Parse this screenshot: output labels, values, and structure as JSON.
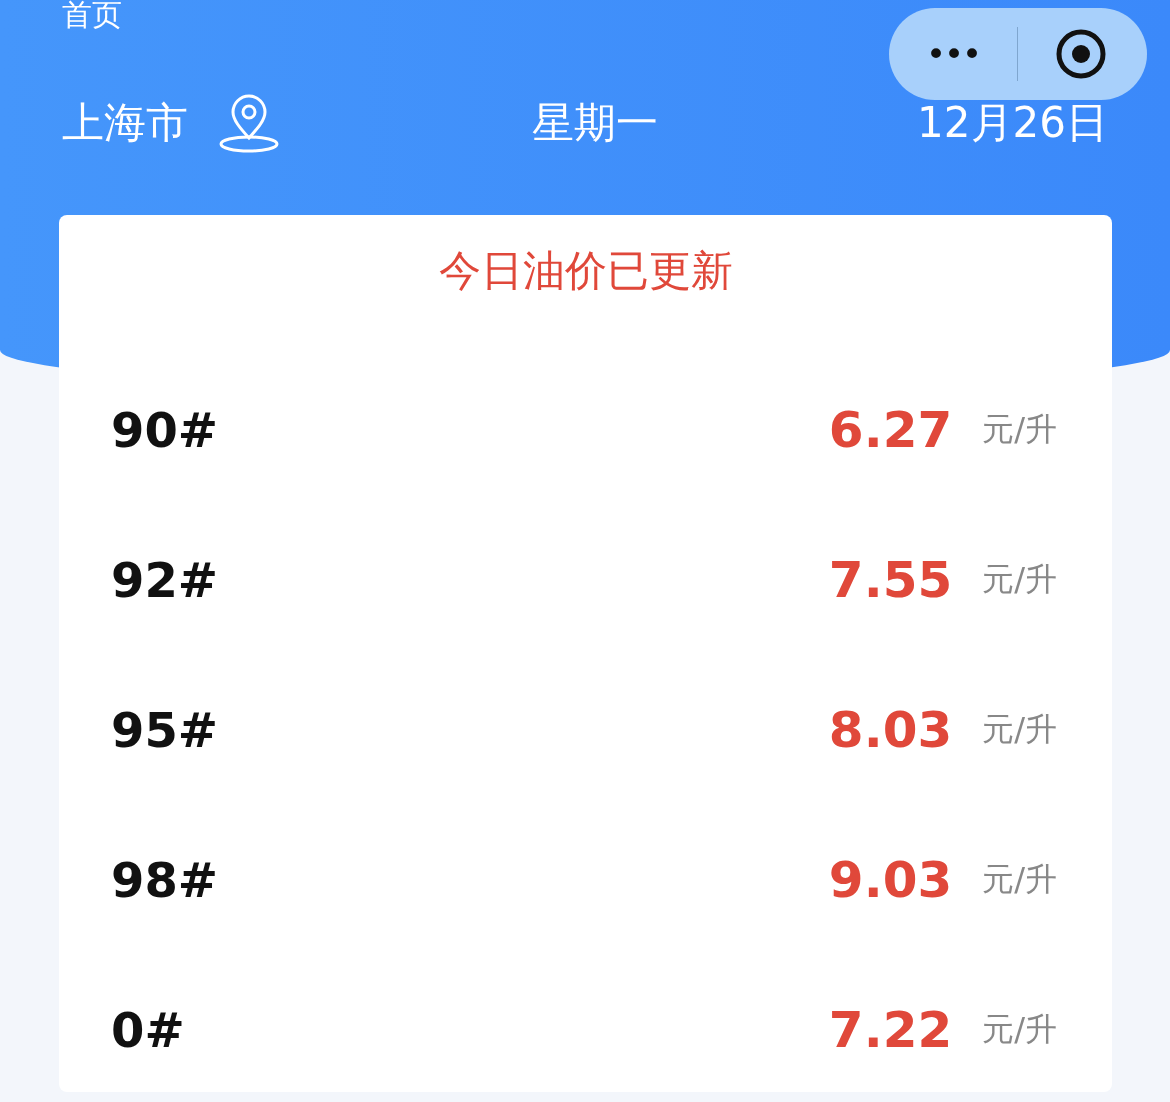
{
  "page_title": "首页",
  "capsule": {
    "more": "•••"
  },
  "header": {
    "city": "上海市",
    "weekday": "星期一",
    "date": "12月26日"
  },
  "card": {
    "notice": "今日油价已更新",
    "prices": [
      {
        "grade": "90#",
        "price": "6.27",
        "unit": "元/升"
      },
      {
        "grade": "92#",
        "price": "7.55",
        "unit": "元/升"
      },
      {
        "grade": "95#",
        "price": "8.03",
        "unit": "元/升"
      },
      {
        "grade": "98#",
        "price": "9.03",
        "unit": "元/升"
      },
      {
        "grade": "0#",
        "price": "7.22",
        "unit": "元/升"
      }
    ]
  }
}
